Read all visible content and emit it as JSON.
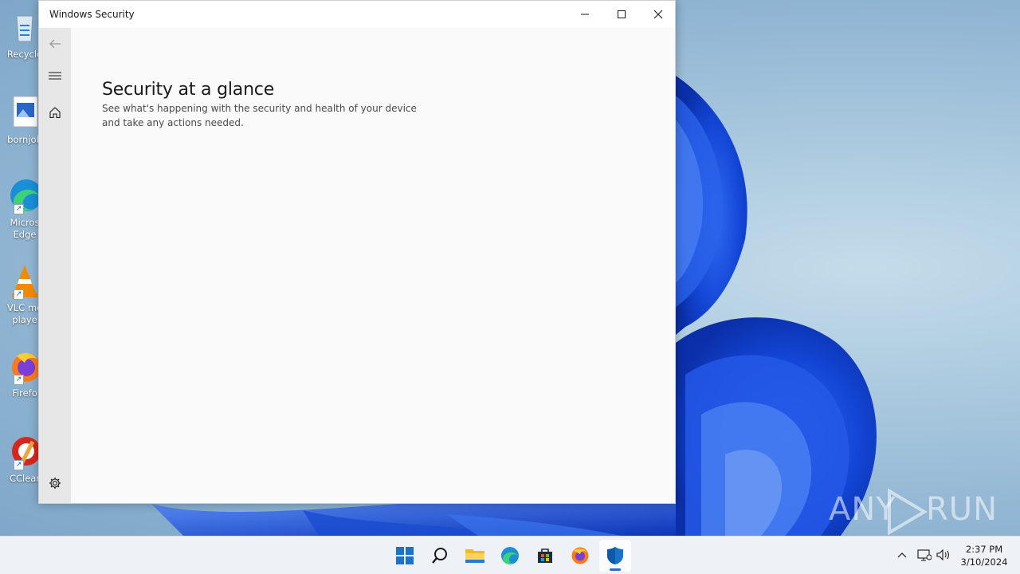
{
  "window": {
    "title": "Windows Security",
    "page_title": "Security at a glance",
    "page_description": "See what's happening with the security and health of your device and take any actions needed."
  },
  "nav": {
    "items": [
      {
        "name": "back",
        "icon": "back-arrow-icon"
      },
      {
        "name": "menu",
        "icon": "hamburger-menu-icon"
      },
      {
        "name": "home",
        "icon": "home-icon"
      },
      {
        "name": "settings",
        "icon": "gear-icon"
      }
    ]
  },
  "desktop": {
    "icons": [
      {
        "label": "Recycle",
        "icon": "recycle-bin-icon"
      },
      {
        "label": "bornjob",
        "icon": "image-file-icon"
      },
      {
        "label": "Micros\nEdge",
        "icon": "edge-icon"
      },
      {
        "label": "VLC me\nplaye",
        "icon": "vlc-icon"
      },
      {
        "label": "Firefo",
        "icon": "firefox-icon"
      },
      {
        "label": "CClear",
        "icon": "ccleaner-icon"
      }
    ]
  },
  "taskbar": {
    "apps": [
      "start-icon",
      "search-icon",
      "file-explorer-icon",
      "edge-icon",
      "store-icon",
      "firefox-icon",
      "windows-security-icon"
    ],
    "active_app": "windows-security-icon",
    "time": "2:37 PM",
    "date": "3/10/2024"
  },
  "watermark": {
    "left": "ANY",
    "right": "RUN"
  },
  "colors": {
    "accent": "#1a73c8",
    "wallpaper_bloom": "#1a4fd6",
    "nav_rail": "#e7e7e7",
    "window_bg": "#fafafa"
  }
}
